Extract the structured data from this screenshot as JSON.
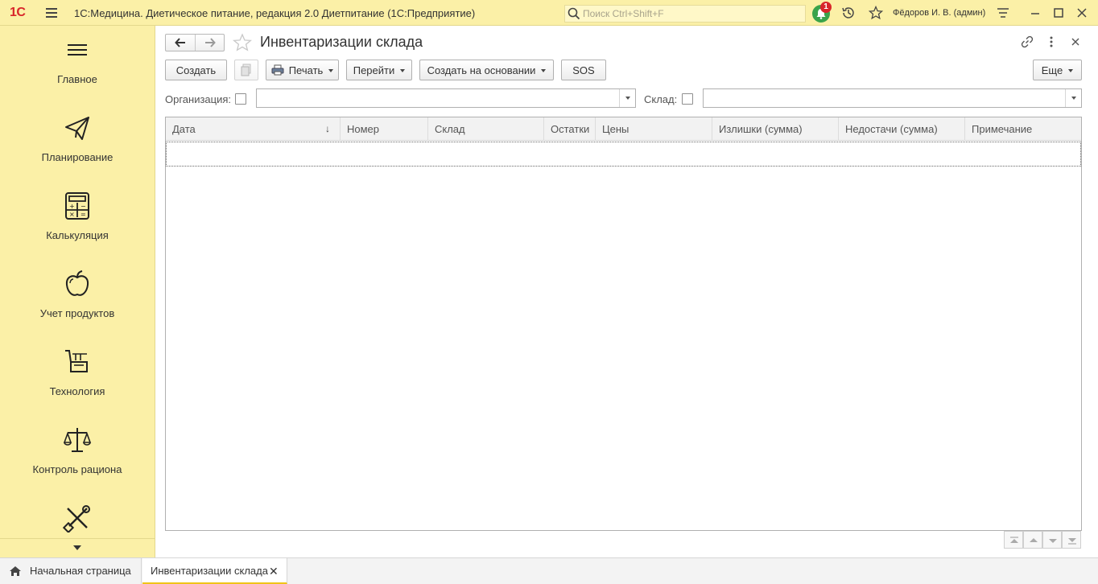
{
  "titlebar": {
    "logo": "1С",
    "app_title": "1С:Медицина. Диетическое питание, редакция 2.0 Диетпитание  (1С:Предприятие)",
    "search_placeholder": "Поиск Ctrl+Shift+F",
    "notifications_count": "1",
    "user": "Фёдоров И. В. (админ)"
  },
  "sidebar": {
    "items": [
      {
        "label": "Главное",
        "icon": "menu-lines-icon"
      },
      {
        "label": "Планирование",
        "icon": "paper-plane-icon"
      },
      {
        "label": "Калькуляция",
        "icon": "calculator-icon"
      },
      {
        "label": "Учет продуктов",
        "icon": "apple-icon"
      },
      {
        "label": "Технология",
        "icon": "cart-icon"
      },
      {
        "label": "Контроль рациона",
        "icon": "scales-icon"
      },
      {
        "label": "",
        "icon": "tools-icon"
      }
    ]
  },
  "form": {
    "title": "Инвентаризации склада",
    "toolbar": {
      "create": "Создать",
      "print": "Печать",
      "goto": "Перейти",
      "create_based_on": "Создать на основании",
      "sos": "SOS",
      "more": "Еще"
    },
    "filters": {
      "organization_label": "Организация:",
      "organization_value": "",
      "warehouse_label": "Склад:",
      "warehouse_value": ""
    },
    "table": {
      "columns": [
        "Дата",
        "Номер",
        "Склад",
        "Остатки",
        "Цены",
        "Излишки (сумма)",
        "Недостачи (сумма)",
        "Примечание"
      ],
      "sort_indicator": "↓",
      "rows": []
    }
  },
  "tabs": {
    "home": "Начальная страница",
    "active": "Инвентаризации склада",
    "close": "✕"
  },
  "colors": {
    "panel": "#fbf0a7",
    "accent_tab": "#f0c419",
    "logo": "#d8262a",
    "notification": "#3aa34a"
  }
}
